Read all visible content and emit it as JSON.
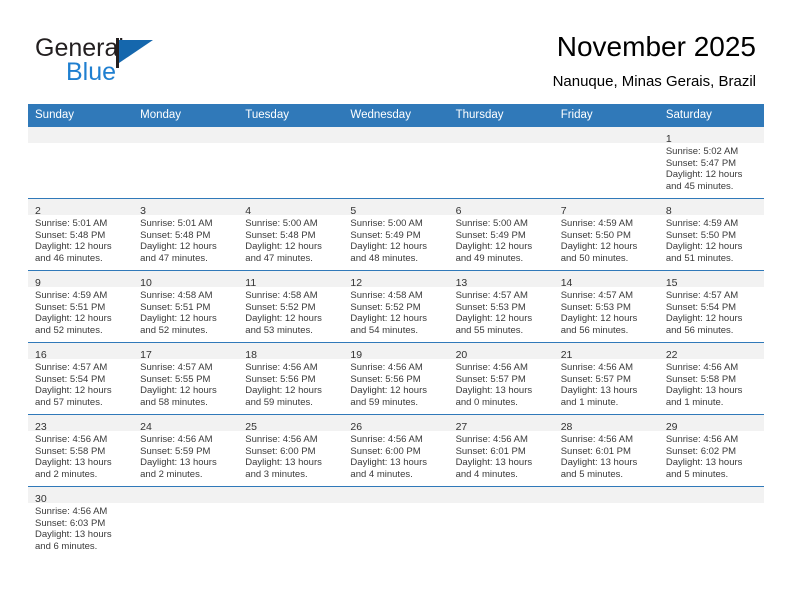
{
  "brand": {
    "name_part1": "General",
    "name_part2": "Blue",
    "flag_icon": "flag-icon",
    "accent_color": "#1567ad",
    "blue_text_color": "#1f7fd0"
  },
  "header": {
    "title": "November 2025",
    "location": "Nanuque, Minas Gerais, Brazil"
  },
  "calendar": {
    "header_bg": "#3079b9",
    "header_text_color": "#ffffff",
    "daynum_band_bg": "#f2f2f2",
    "weekday_headers": [
      "Sunday",
      "Monday",
      "Tuesday",
      "Wednesday",
      "Thursday",
      "Friday",
      "Saturday"
    ],
    "weeks": [
      [
        {
          "day": "",
          "sunrise": "",
          "sunset": "",
          "daylight1": "",
          "daylight2": ""
        },
        {
          "day": "",
          "sunrise": "",
          "sunset": "",
          "daylight1": "",
          "daylight2": ""
        },
        {
          "day": "",
          "sunrise": "",
          "sunset": "",
          "daylight1": "",
          "daylight2": ""
        },
        {
          "day": "",
          "sunrise": "",
          "sunset": "",
          "daylight1": "",
          "daylight2": ""
        },
        {
          "day": "",
          "sunrise": "",
          "sunset": "",
          "daylight1": "",
          "daylight2": ""
        },
        {
          "day": "",
          "sunrise": "",
          "sunset": "",
          "daylight1": "",
          "daylight2": ""
        },
        {
          "day": "1",
          "sunrise": "Sunrise: 5:02 AM",
          "sunset": "Sunset: 5:47 PM",
          "daylight1": "Daylight: 12 hours",
          "daylight2": "and 45 minutes."
        }
      ],
      [
        {
          "day": "2",
          "sunrise": "Sunrise: 5:01 AM",
          "sunset": "Sunset: 5:48 PM",
          "daylight1": "Daylight: 12 hours",
          "daylight2": "and 46 minutes."
        },
        {
          "day": "3",
          "sunrise": "Sunrise: 5:01 AM",
          "sunset": "Sunset: 5:48 PM",
          "daylight1": "Daylight: 12 hours",
          "daylight2": "and 47 minutes."
        },
        {
          "day": "4",
          "sunrise": "Sunrise: 5:00 AM",
          "sunset": "Sunset: 5:48 PM",
          "daylight1": "Daylight: 12 hours",
          "daylight2": "and 47 minutes."
        },
        {
          "day": "5",
          "sunrise": "Sunrise: 5:00 AM",
          "sunset": "Sunset: 5:49 PM",
          "daylight1": "Daylight: 12 hours",
          "daylight2": "and 48 minutes."
        },
        {
          "day": "6",
          "sunrise": "Sunrise: 5:00 AM",
          "sunset": "Sunset: 5:49 PM",
          "daylight1": "Daylight: 12 hours",
          "daylight2": "and 49 minutes."
        },
        {
          "day": "7",
          "sunrise": "Sunrise: 4:59 AM",
          "sunset": "Sunset: 5:50 PM",
          "daylight1": "Daylight: 12 hours",
          "daylight2": "and 50 minutes."
        },
        {
          "day": "8",
          "sunrise": "Sunrise: 4:59 AM",
          "sunset": "Sunset: 5:50 PM",
          "daylight1": "Daylight: 12 hours",
          "daylight2": "and 51 minutes."
        }
      ],
      [
        {
          "day": "9",
          "sunrise": "Sunrise: 4:59 AM",
          "sunset": "Sunset: 5:51 PM",
          "daylight1": "Daylight: 12 hours",
          "daylight2": "and 52 minutes."
        },
        {
          "day": "10",
          "sunrise": "Sunrise: 4:58 AM",
          "sunset": "Sunset: 5:51 PM",
          "daylight1": "Daylight: 12 hours",
          "daylight2": "and 52 minutes."
        },
        {
          "day": "11",
          "sunrise": "Sunrise: 4:58 AM",
          "sunset": "Sunset: 5:52 PM",
          "daylight1": "Daylight: 12 hours",
          "daylight2": "and 53 minutes."
        },
        {
          "day": "12",
          "sunrise": "Sunrise: 4:58 AM",
          "sunset": "Sunset: 5:52 PM",
          "daylight1": "Daylight: 12 hours",
          "daylight2": "and 54 minutes."
        },
        {
          "day": "13",
          "sunrise": "Sunrise: 4:57 AM",
          "sunset": "Sunset: 5:53 PM",
          "daylight1": "Daylight: 12 hours",
          "daylight2": "and 55 minutes."
        },
        {
          "day": "14",
          "sunrise": "Sunrise: 4:57 AM",
          "sunset": "Sunset: 5:53 PM",
          "daylight1": "Daylight: 12 hours",
          "daylight2": "and 56 minutes."
        },
        {
          "day": "15",
          "sunrise": "Sunrise: 4:57 AM",
          "sunset": "Sunset: 5:54 PM",
          "daylight1": "Daylight: 12 hours",
          "daylight2": "and 56 minutes."
        }
      ],
      [
        {
          "day": "16",
          "sunrise": "Sunrise: 4:57 AM",
          "sunset": "Sunset: 5:54 PM",
          "daylight1": "Daylight: 12 hours",
          "daylight2": "and 57 minutes."
        },
        {
          "day": "17",
          "sunrise": "Sunrise: 4:57 AM",
          "sunset": "Sunset: 5:55 PM",
          "daylight1": "Daylight: 12 hours",
          "daylight2": "and 58 minutes."
        },
        {
          "day": "18",
          "sunrise": "Sunrise: 4:56 AM",
          "sunset": "Sunset: 5:56 PM",
          "daylight1": "Daylight: 12 hours",
          "daylight2": "and 59 minutes."
        },
        {
          "day": "19",
          "sunrise": "Sunrise: 4:56 AM",
          "sunset": "Sunset: 5:56 PM",
          "daylight1": "Daylight: 12 hours",
          "daylight2": "and 59 minutes."
        },
        {
          "day": "20",
          "sunrise": "Sunrise: 4:56 AM",
          "sunset": "Sunset: 5:57 PM",
          "daylight1": "Daylight: 13 hours",
          "daylight2": "and 0 minutes."
        },
        {
          "day": "21",
          "sunrise": "Sunrise: 4:56 AM",
          "sunset": "Sunset: 5:57 PM",
          "daylight1": "Daylight: 13 hours",
          "daylight2": "and 1 minute."
        },
        {
          "day": "22",
          "sunrise": "Sunrise: 4:56 AM",
          "sunset": "Sunset: 5:58 PM",
          "daylight1": "Daylight: 13 hours",
          "daylight2": "and 1 minute."
        }
      ],
      [
        {
          "day": "23",
          "sunrise": "Sunrise: 4:56 AM",
          "sunset": "Sunset: 5:58 PM",
          "daylight1": "Daylight: 13 hours",
          "daylight2": "and 2 minutes."
        },
        {
          "day": "24",
          "sunrise": "Sunrise: 4:56 AM",
          "sunset": "Sunset: 5:59 PM",
          "daylight1": "Daylight: 13 hours",
          "daylight2": "and 2 minutes."
        },
        {
          "day": "25",
          "sunrise": "Sunrise: 4:56 AM",
          "sunset": "Sunset: 6:00 PM",
          "daylight1": "Daylight: 13 hours",
          "daylight2": "and 3 minutes."
        },
        {
          "day": "26",
          "sunrise": "Sunrise: 4:56 AM",
          "sunset": "Sunset: 6:00 PM",
          "daylight1": "Daylight: 13 hours",
          "daylight2": "and 4 minutes."
        },
        {
          "day": "27",
          "sunrise": "Sunrise: 4:56 AM",
          "sunset": "Sunset: 6:01 PM",
          "daylight1": "Daylight: 13 hours",
          "daylight2": "and 4 minutes."
        },
        {
          "day": "28",
          "sunrise": "Sunrise: 4:56 AM",
          "sunset": "Sunset: 6:01 PM",
          "daylight1": "Daylight: 13 hours",
          "daylight2": "and 5 minutes."
        },
        {
          "day": "29",
          "sunrise": "Sunrise: 4:56 AM",
          "sunset": "Sunset: 6:02 PM",
          "daylight1": "Daylight: 13 hours",
          "daylight2": "and 5 minutes."
        }
      ],
      [
        {
          "day": "30",
          "sunrise": "Sunrise: 4:56 AM",
          "sunset": "Sunset: 6:03 PM",
          "daylight1": "Daylight: 13 hours",
          "daylight2": "and 6 minutes."
        },
        {
          "day": "",
          "sunrise": "",
          "sunset": "",
          "daylight1": "",
          "daylight2": ""
        },
        {
          "day": "",
          "sunrise": "",
          "sunset": "",
          "daylight1": "",
          "daylight2": ""
        },
        {
          "day": "",
          "sunrise": "",
          "sunset": "",
          "daylight1": "",
          "daylight2": ""
        },
        {
          "day": "",
          "sunrise": "",
          "sunset": "",
          "daylight1": "",
          "daylight2": ""
        },
        {
          "day": "",
          "sunrise": "",
          "sunset": "",
          "daylight1": "",
          "daylight2": ""
        },
        {
          "day": "",
          "sunrise": "",
          "sunset": "",
          "daylight1": "",
          "daylight2": ""
        }
      ]
    ]
  }
}
